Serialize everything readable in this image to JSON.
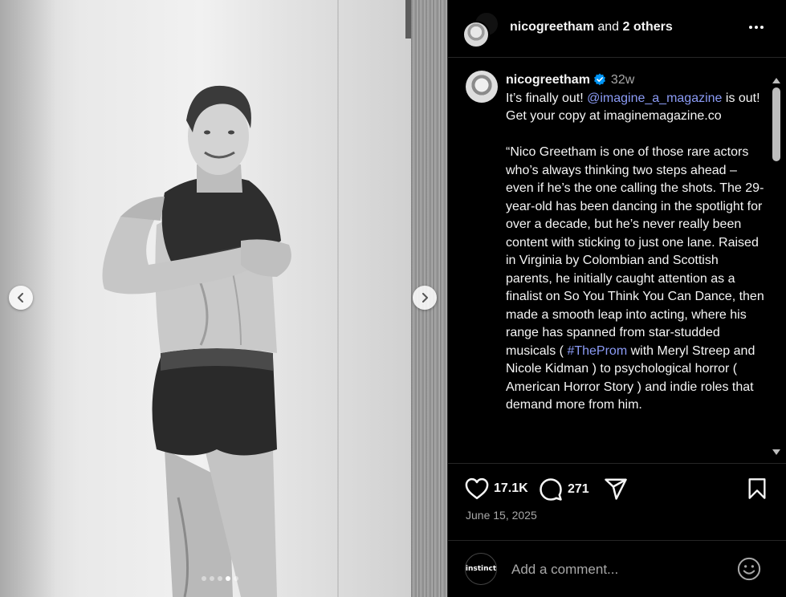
{
  "post": {
    "header": {
      "username": "nicogreetham",
      "collab_text": "and",
      "others_label": "2 others"
    },
    "caption": {
      "username": "nicogreetham",
      "verified": true,
      "time_ago": "32w",
      "intro_before": "It’s finally out! ",
      "mention": "@imagine_a_magazine",
      "intro_after": " is out! Get your copy at imaginemagazine.co",
      "quote_part1": "“Nico Greetham is one of those rare actors who’s always thinking two steps ahead – even if he’s the one calling the shots. The 29-year-old has been dancing in the spotlight for over a decade, but he’s never really been content with sticking to just one lane. Raised in Virginia by Colombian and Scottish parents, he initially caught attention as a finalist on So You Think You Can Dance, then made a smooth leap into acting, where his range has spanned from star-studded musicals ( ",
      "hashtag": "#TheProm",
      "quote_part2": " with Meryl Streep and Nicole Kidman ) to psychological horror ( American Horror Story ) and indie roles that demand more from him."
    },
    "likes": "17.1K",
    "comments": "271",
    "date": "June 15, 2025",
    "carousel": {
      "total": 5,
      "active_index": 3
    },
    "comment_box": {
      "placeholder": "Add a comment...",
      "avatar_text": "instinct"
    },
    "icons": {
      "more": "more-horizontal-icon",
      "like": "heart-icon",
      "comment": "comment-bubble-icon",
      "share": "send-paper-plane-icon",
      "save": "bookmark-icon",
      "emoji": "smiley-emoji-icon",
      "verified": "verified-badge-icon",
      "prev": "chevron-left-icon",
      "next": "chevron-right-icon"
    },
    "colors": {
      "background": "#000000",
      "text": "#f5f5f5",
      "muted": "#a8a8a8",
      "link": "#8b9bf5",
      "verified": "#0095f6",
      "border": "#262626"
    }
  }
}
